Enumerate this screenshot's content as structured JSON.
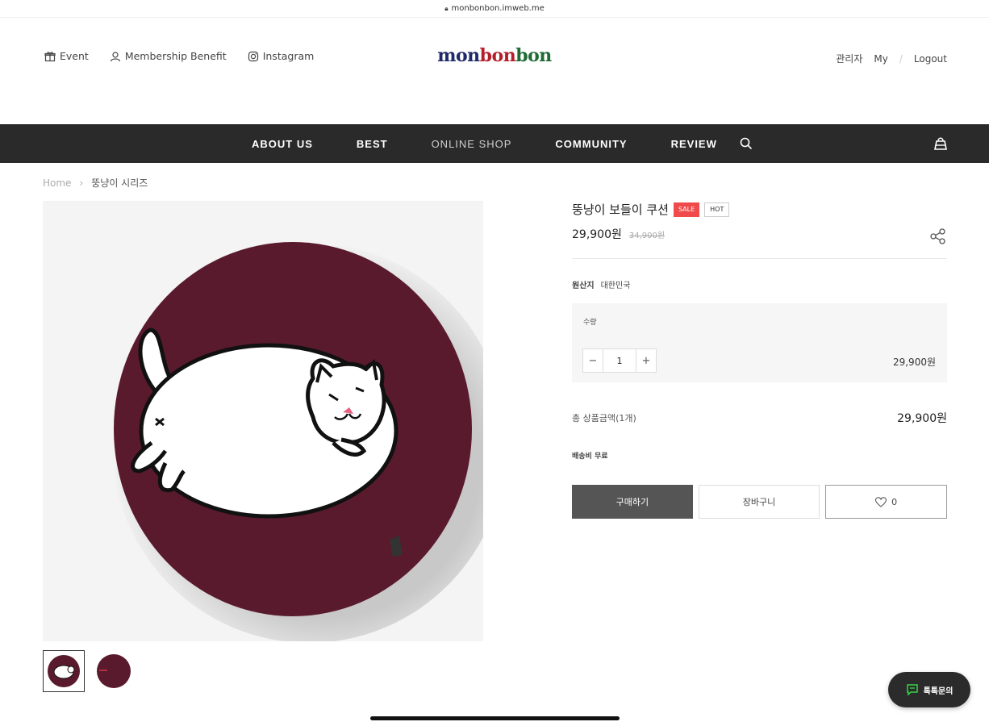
{
  "browser": {
    "url": "monbonbon.imweb.me"
  },
  "header": {
    "links": [
      {
        "label": "Event",
        "icon": "gift-icon"
      },
      {
        "label": "Membership Benefit",
        "icon": "user-icon"
      },
      {
        "label": "Instagram",
        "icon": "instagram-icon"
      }
    ],
    "logo": {
      "part1": "mon",
      "part2": "bon",
      "part3": "bon"
    },
    "account": {
      "admin": "관리자",
      "my": "My",
      "logout": "Logout"
    }
  },
  "nav": {
    "items": [
      "ABOUT US",
      "BEST",
      "ONLINE SHOP",
      "COMMUNITY",
      "REVIEW"
    ]
  },
  "breadcrumb": {
    "home": "Home",
    "current": "뚱냥이 시리즈"
  },
  "product": {
    "title": "뚱냥이 보들이 쿠션",
    "badge_sale": "SALE",
    "badge_hot": "HOT",
    "price": "29,900원",
    "original_price": "34,900원",
    "origin_label": "원산지",
    "origin_value": "대한민국",
    "option_label": "수량",
    "quantity": "1",
    "option_price": "29,900원",
    "total_label": "총 상품금액(1개)",
    "total_value": "29,900원",
    "shipping": "배송비 무료",
    "buy_label": "구매하기",
    "cart_label": "장바구니",
    "like_count": "0"
  },
  "chat": {
    "label": "톡톡문의"
  },
  "colors": {
    "nav_bg": "#2a2a2a",
    "sale_badge": "#f04a4a",
    "cushion": "#5a1a2e",
    "buy_button": "#555555"
  }
}
